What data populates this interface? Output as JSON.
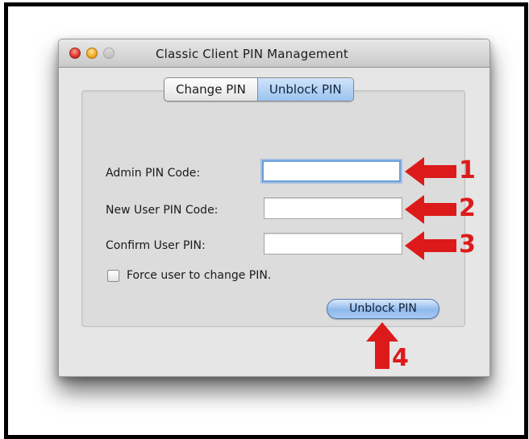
{
  "window": {
    "title": "Classic Client PIN Management"
  },
  "tabs": [
    {
      "label": "Change PIN",
      "active": false
    },
    {
      "label": "Unblock PIN",
      "active": true
    }
  ],
  "form": {
    "admin_pin_label": "Admin PIN Code:",
    "admin_pin_value": "",
    "new_pin_label": "New User PIN Code:",
    "new_pin_value": "",
    "confirm_pin_label": "Confirm User PIN:",
    "confirm_pin_value": "",
    "force_change_label": "Force user to change PIN.",
    "force_change_checked": false,
    "submit_label": "Unblock PIN"
  },
  "callouts": [
    "1",
    "2",
    "3",
    "4"
  ],
  "colors": {
    "accent": "#8fb9ec",
    "callout": "#dd1a1a"
  }
}
